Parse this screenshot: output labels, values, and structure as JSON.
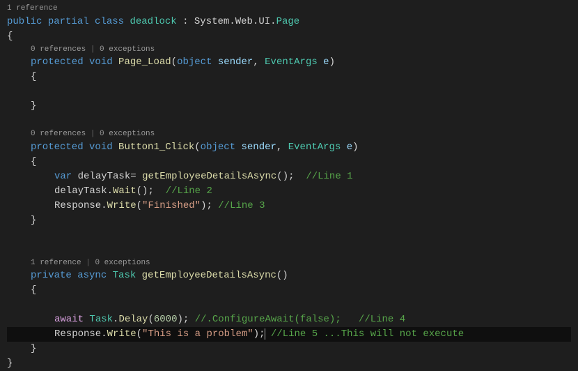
{
  "codelens": {
    "class": {
      "refs": "1 reference"
    },
    "pageLoad": {
      "refs": "0 references",
      "exc": "0 exceptions"
    },
    "button1": {
      "refs": "0 references",
      "exc": "0 exceptions"
    },
    "getEmp": {
      "refs": "1 reference",
      "exc": "0 exceptions"
    },
    "separator": " | "
  },
  "kw": {
    "public": "public",
    "partial": "partial",
    "class": "class",
    "protected": "protected",
    "void": "void",
    "object": "object",
    "var": "var",
    "private": "private",
    "async": "async",
    "await": "await"
  },
  "types": {
    "deadlock": "deadlock",
    "System": "System",
    "Web": "Web",
    "UI": "UI",
    "Page": "Page",
    "EventArgs": "EventArgs",
    "Task": "Task"
  },
  "names": {
    "Page_Load": "Page_Load",
    "Button1_Click": "Button1_Click",
    "sender": "sender",
    "e": "e",
    "delayTask": "delayTask",
    "getEmployeeDetailsAsync": "getEmployeeDetailsAsync",
    "Wait": "Wait",
    "Response": "Response",
    "Write": "Write",
    "Delay": "Delay"
  },
  "strings": {
    "finished": "\"Finished\"",
    "problem": "\"This is a problem\""
  },
  "numbers": {
    "delay": "6000"
  },
  "comments": {
    "line1": "//Line 1",
    "line2": "//Line 2",
    "line3": "//Line 3",
    "configure": "//.ConfigureAwait(false);   //Line 4",
    "line5": "//Line 5 ...This will not execute"
  },
  "punct": {
    "lbrace": "{",
    "rbrace": "}",
    "lparen": "(",
    "rparen": ")",
    "semi": ";",
    "comma": ", ",
    "dot": ".",
    "colon": " : ",
    "eq": "= "
  }
}
